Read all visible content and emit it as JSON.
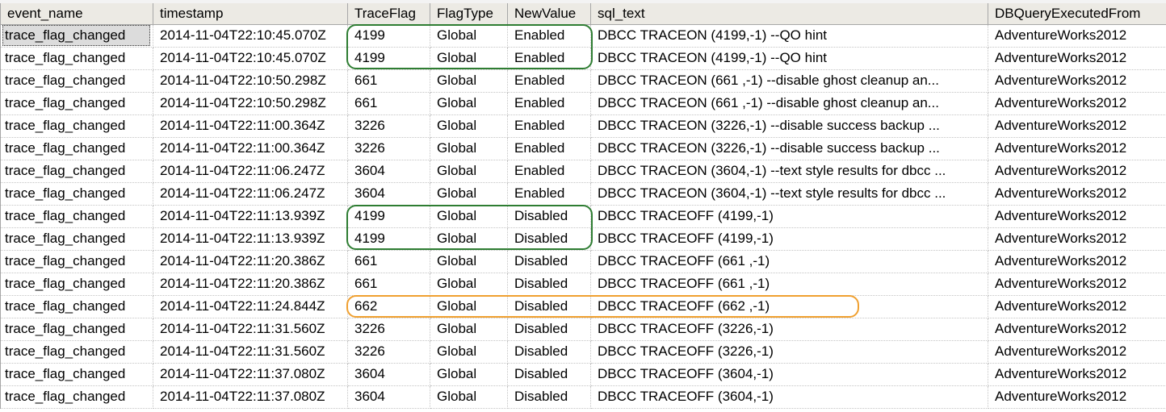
{
  "columns": [
    "event_name",
    "timestamp",
    "TraceFlag",
    "FlagType",
    "NewValue",
    "sql_text",
    "DBQueryExecutedFrom"
  ],
  "rows": [
    [
      "trace_flag_changed",
      "2014-11-04T22:10:45.070Z",
      "4199",
      "Global",
      "Enabled",
      "DBCC TRACEON (4199,-1) --QO hint",
      "AdventureWorks2012"
    ],
    [
      "trace_flag_changed",
      "2014-11-04T22:10:45.070Z",
      "4199",
      "Global",
      "Enabled",
      "DBCC TRACEON (4199,-1) --QO hint",
      "AdventureWorks2012"
    ],
    [
      "trace_flag_changed",
      "2014-11-04T22:10:50.298Z",
      "661",
      "Global",
      "Enabled",
      "DBCC TRACEON (661 ,-1) --disable ghost cleanup an...",
      "AdventureWorks2012"
    ],
    [
      "trace_flag_changed",
      "2014-11-04T22:10:50.298Z",
      "661",
      "Global",
      "Enabled",
      "DBCC TRACEON (661 ,-1) --disable ghost cleanup an...",
      "AdventureWorks2012"
    ],
    [
      "trace_flag_changed",
      "2014-11-04T22:11:00.364Z",
      "3226",
      "Global",
      "Enabled",
      "DBCC TRACEON (3226,-1) --disable success backup ...",
      "AdventureWorks2012"
    ],
    [
      "trace_flag_changed",
      "2014-11-04T22:11:00.364Z",
      "3226",
      "Global",
      "Enabled",
      "DBCC TRACEON (3226,-1) --disable success backup ...",
      "AdventureWorks2012"
    ],
    [
      "trace_flag_changed",
      "2014-11-04T22:11:06.247Z",
      "3604",
      "Global",
      "Enabled",
      "DBCC TRACEON (3604,-1) --text style results for dbcc ...",
      "AdventureWorks2012"
    ],
    [
      "trace_flag_changed",
      "2014-11-04T22:11:06.247Z",
      "3604",
      "Global",
      "Enabled",
      "DBCC TRACEON (3604,-1) --text style results for dbcc ...",
      "AdventureWorks2012"
    ],
    [
      "trace_flag_changed",
      "2014-11-04T22:11:13.939Z",
      "4199",
      "Global",
      "Disabled",
      "DBCC TRACEOFF (4199,-1)",
      "AdventureWorks2012"
    ],
    [
      "trace_flag_changed",
      "2014-11-04T22:11:13.939Z",
      "4199",
      "Global",
      "Disabled",
      "DBCC TRACEOFF (4199,-1)",
      "AdventureWorks2012"
    ],
    [
      "trace_flag_changed",
      "2014-11-04T22:11:20.386Z",
      "661",
      "Global",
      "Disabled",
      "DBCC TRACEOFF (661 ,-1)",
      "AdventureWorks2012"
    ],
    [
      "trace_flag_changed",
      "2014-11-04T22:11:20.386Z",
      "661",
      "Global",
      "Disabled",
      "DBCC TRACEOFF (661 ,-1)",
      "AdventureWorks2012"
    ],
    [
      "trace_flag_changed",
      "2014-11-04T22:11:24.844Z",
      "662",
      "Global",
      "Disabled",
      "DBCC TRACEOFF (662 ,-1)",
      "AdventureWorks2012"
    ],
    [
      "trace_flag_changed",
      "2014-11-04T22:11:31.560Z",
      "3226",
      "Global",
      "Disabled",
      "DBCC TRACEOFF (3226,-1)",
      "AdventureWorks2012"
    ],
    [
      "trace_flag_changed",
      "2014-11-04T22:11:31.560Z",
      "3226",
      "Global",
      "Disabled",
      "DBCC TRACEOFF (3226,-1)",
      "AdventureWorks2012"
    ],
    [
      "trace_flag_changed",
      "2014-11-04T22:11:37.080Z",
      "3604",
      "Global",
      "Disabled",
      "DBCC TRACEOFF (3604,-1)",
      "AdventureWorks2012"
    ],
    [
      "trace_flag_changed",
      "2014-11-04T22:11:37.080Z",
      "3604",
      "Global",
      "Disabled",
      "DBCC TRACEOFF (3604,-1)",
      "AdventureWorks2012"
    ]
  ],
  "selected_row": 0,
  "highlights": [
    {
      "name": "green-highlight-enabled-4199",
      "color": "#2e7d32",
      "rows": [
        0,
        1
      ],
      "from_col": 2,
      "to_col": 4
    },
    {
      "name": "green-highlight-disabled-4199",
      "color": "#2e7d32",
      "rows": [
        8,
        9
      ],
      "from_col": 2,
      "to_col": 4
    },
    {
      "name": "orange-highlight-662",
      "color": "#f0a030",
      "rows": [
        12,
        12
      ],
      "from_col": 2,
      "to_col": 5
    }
  ]
}
